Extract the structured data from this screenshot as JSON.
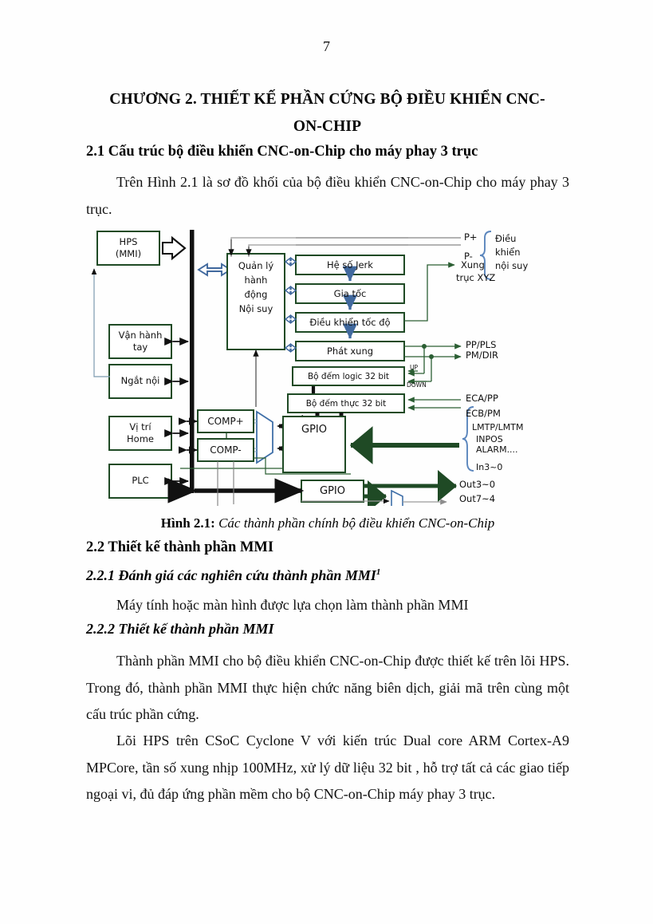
{
  "page": {
    "number": "7"
  },
  "chapter": {
    "title_line1": "CHƯƠNG 2. THIẾT KẾ PHẦN CỨNG BỘ ĐIỀU KHIỂN CNC-",
    "title_line2": "ON-CHIP"
  },
  "sections": {
    "s21_heading": "2.1 Cấu trúc bộ điều khiển CNC-on-Chip cho máy phay 3 trục",
    "s21_para": "Trên Hình 2.1 là sơ đồ khối của bộ điều khiển CNC-on-Chip cho máy phay 3 trục.",
    "s22_heading": "2.2 Thiết kế thành phần MMI",
    "s221_heading": "2.2.1 Đánh giá các nghiên cứu thành phần MMI",
    "s221_footnote_marker": "1",
    "s221_para": "Máy tính hoặc màn hình được lựa chọn làm thành phần MMI",
    "s222_heading": "2.2.2 Thiết kế thành phần MMI",
    "s222_para1": "Thành phần MMI cho bộ điều khiển CNC-on-Chip được thiết kế trên lõi HPS. Trong đó, thành phần MMI thực hiện chức năng biên dịch, giải mã trên cùng một cấu trúc phần cứng.",
    "s222_para2": "Lõi HPS trên CSoC Cyclone V với kiến trúc Dual core ARM Cortex-A9 MPCore, tần số xung nhịp 100MHz, xử lý dữ liệu 32 bit , hỗ trợ tất cả các giao tiếp ngoại vi, đủ đáp ứng phần mềm cho bộ CNC-on-Chip máy phay 3 trục."
  },
  "figure": {
    "caption_label": "Hình 2.1:",
    "caption_text": "Các thành phần chính bộ điều khiển CNC-on-Chip",
    "colors": {
      "box_border": "#1f4a25",
      "bus_black": "#111111",
      "blue_arrow": "#3f6fa8",
      "gray_line": "#9a9a9a",
      "green_arrow": "#1f4a25",
      "brace_blue": "#5b86bd"
    },
    "boxes": {
      "hps": "HPS\n(MMI)",
      "hps_line1": "HPS",
      "hps_line2": "(MMI)",
      "van_hanh_tay_line1": "Vận hành",
      "van_hanh_tay_line2": "tay",
      "ngat_noi": "Ngắt nội",
      "vi_tri_home_line1": "Vị trí",
      "vi_tri_home_line2": "Home",
      "plc": "PLC",
      "quan_ly_l1": "Quản lý",
      "quan_ly_l2": "hành",
      "quan_ly_l3": "động",
      "quan_ly_l4": "Nội suy",
      "he_so_jerk": "Hệ số Jerk",
      "gia_toc": "Gia tốc",
      "dieu_khien_toc_do": "Điều khiển tốc độ",
      "phat_xung": "Phát xung",
      "bo_dem_logic": "Bộ đếm logic 32 bit",
      "bo_dem_thuc": "Bộ đếm thực 32 bit",
      "comp_plus": "COMP+",
      "comp_minus": "COMP-",
      "gpio_1": "GPIO",
      "gpio_2": "GPIO"
    },
    "labels": {
      "p_plus": "P+",
      "p_minus": "P-",
      "xung": "Xung",
      "truc_xyz": "trục XYZ",
      "dieu_l1": "Điều",
      "dieu_l2": "khiển",
      "dieu_l3": "nội suy",
      "pp_pls": "PP/PLS",
      "pm_dir": "PM/DIR",
      "up": "UP",
      "down": "DOWN",
      "eca_pp": "ECA/PP",
      "ecb_pm": "ECB/PM",
      "lmtp_lmtm": "LMTP/LMTM",
      "inpos": "INPOS",
      "alarm": "ALARM....",
      "in3_0": "In3~0",
      "out3_0": "Out3~0",
      "out7_4": "Out7~4"
    }
  }
}
